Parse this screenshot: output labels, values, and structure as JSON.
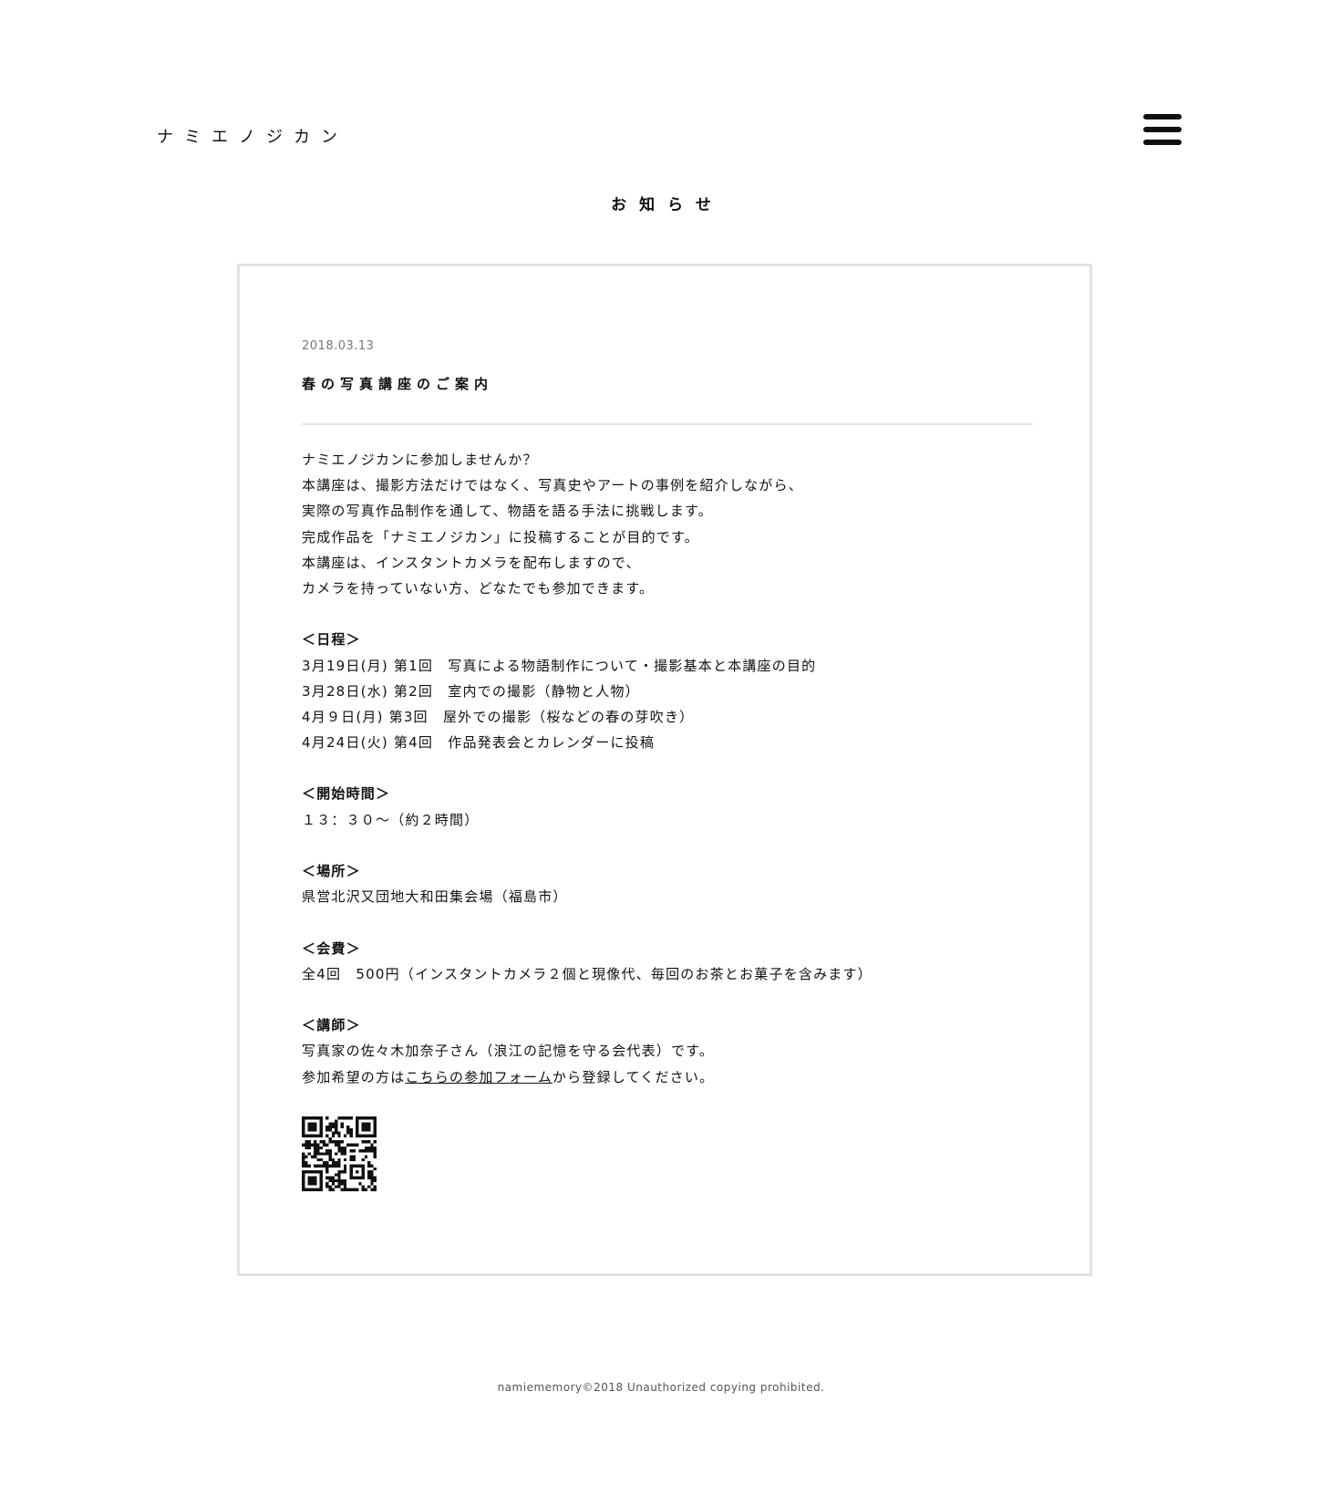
{
  "header": {
    "site_title": "ナミエノジカン",
    "menu_icon": "hamburger-menu-icon"
  },
  "page": {
    "heading": "お知らせ"
  },
  "post": {
    "date": "2018.03.13",
    "title": "春の写真講座のご案内",
    "intro": [
      "ナミエノジカンに参加しませんか？",
      "本講座は、撮影方法だけではなく、写真史やアートの事例を紹介しながら、",
      "実際の写真作品制作を通して、物語を語る手法に挑戦します。",
      "完成作品を「ナミエノジカン」に投稿することが目的です。",
      "本講座は、インスタントカメラを配布しますので、",
      "カメラを持っていない方、どなたでも参加できます。"
    ],
    "schedule": {
      "heading": "＜日程＞",
      "items": [
        "3月19日(月) 第1回　写真による物語制作について・撮影基本と本講座の目的",
        "3月28日(水) 第2回　室内での撮影（静物と人物）",
        "4月９日(月) 第3回　屋外での撮影（桜などの春の芽吹き）",
        "4月24日(火) 第4回　作品発表会とカレンダーに投稿"
      ]
    },
    "start_time": {
      "heading": "＜開始時間＞",
      "text": "１３：３０～（約２時間）"
    },
    "venue": {
      "heading": "＜場所＞",
      "text": "県営北沢又団地大和田集会場（福島市）"
    },
    "fee": {
      "heading": "＜会費＞",
      "text": "全4回　500円（インスタントカメラ２個と現像代、毎回のお茶とお菓子を含みます）"
    },
    "instructor": {
      "heading": "＜講師＞",
      "text": "写真家の佐々木加奈子さん（浪江の記憶を守る会代表）です。",
      "signup_prefix": "参加希望の方は",
      "signup_link": "こちらの参加フォーム",
      "signup_suffix": "から登録してください。"
    },
    "qr_icon": "qr-code-icon"
  },
  "footer": {
    "copyright": "namiememory©2018 Unauthorized copying prohibited."
  }
}
